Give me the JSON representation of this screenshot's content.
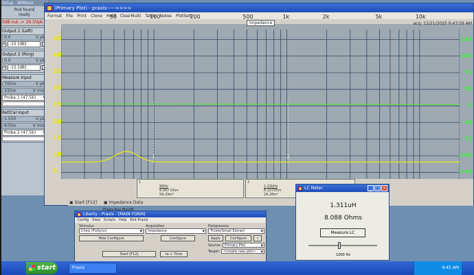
{
  "left_panel": {
    "tabs": [
      "Setup",
      "WiMove"
    ],
    "pod_found": "Pod found",
    "pod_ready": "ready",
    "warning": "0dB out -> 29.3Vpk",
    "output1": {
      "title": "Output 1 (Left)",
      "vpk_value": "0.0",
      "vpk_unit": "V pk",
      "db_value": "-15",
      "db_unit": "[dB]"
    },
    "output2": {
      "title": "Output 2 (Ring)",
      "vpk_value": "0.0",
      "vpk_unit": "V pk",
      "db_value": "-15",
      "db_unit": "[dB]"
    },
    "measure_input": {
      "title": "Measure Input",
      "vpk": "795m",
      "vpk_unit": "V pk",
      "vrms": "335m",
      "vrms_unit": "V rms",
      "probe": "Probe 1 (47.5k)"
    },
    "refcal_input": {
      "title": "Ref/Cal Input",
      "vpk": "1.550",
      "vpk_unit": "V pk",
      "vrms": "670m",
      "vrms_unit": "V rms",
      "probe": "Probe 2 (47.5k)"
    }
  },
  "plot_window": {
    "title": "(Primary Plot) - praxis----->>>>",
    "menu": [
      "Format",
      "File",
      "Print",
      "Clone",
      "Hold",
      "ClearMulti",
      "Table",
      "Notes",
      "PlotSets"
    ],
    "plot_label": "Impedance",
    "acq_stamp": "acq: 12/21/2025 9:43:59 AM",
    "x_ticks": [
      {
        "label": "50",
        "x": 50
      },
      {
        "label": "100",
        "x": 100
      },
      {
        "label": "200",
        "x": 200
      },
      {
        "label": "500",
        "x": 500
      },
      {
        "label": "1k",
        "x": 1000
      },
      {
        "label": "2k",
        "x": 2000
      },
      {
        "label": "5k",
        "x": 5000
      },
      {
        "label": "10k",
        "x": 10000
      }
    ],
    "y_left_ticks": [
      {
        "label": "45",
        "v": 45
      },
      {
        "label": "40",
        "v": 40
      },
      {
        "label": "35",
        "v": 35
      },
      {
        "label": "30",
        "v": 30
      },
      {
        "label": "25",
        "v": 25
      },
      {
        "label": "20",
        "v": 20
      },
      {
        "label": "15",
        "v": 15
      },
      {
        "label": "10",
        "v": 10
      },
      {
        "label": "5",
        "v": 5
      }
    ],
    "y_right_ticks": [
      {
        "label": "144",
        "v": 144
      },
      {
        "label": "108",
        "v": 108
      },
      {
        "label": "72",
        "v": 72
      },
      {
        "label": "36",
        "v": 36
      },
      {
        "label": "0",
        "v": 0
      },
      {
        "label": "-36",
        "v": -36
      },
      {
        "label": "-72",
        "v": -72
      },
      {
        "label": "-108",
        "v": -108
      },
      {
        "label": "-144",
        "v": -144
      }
    ],
    "cursor1": {
      "index": "1",
      "freq": "99Hz",
      "mag": "8.067 Ohm",
      "phase": "59.29m°"
    },
    "cursor2": {
      "index": "2",
      "freq": "1.02kHz",
      "mag": "8.1070hm",
      "phase": "29.28m°"
    },
    "status_start": "Start [F12]",
    "status_data": "Impedance Data",
    "colors": {
      "magnitude": "#e3e51a",
      "phase": "#52e035",
      "grid": "#2f4a63",
      "background": "#9ea9b2"
    }
  },
  "main_form": {
    "title": "Liberty - Praxis - [MAIN FORM]",
    "menu": [
      "Config",
      "View",
      "Scripts",
      "Help",
      "Exit Praxis"
    ],
    "stimulus_label": "Stimulus",
    "stimulus_value": "Chirp (FixSync)",
    "hide_configure": "Hide Configure",
    "acquisition_label": "Acquisition",
    "acquisition_value": "Impedance",
    "configure": "Configure",
    "postprocess_label": "Postprocess",
    "postprocess_value": "Thiele/Small Extract",
    "apply": "Apply",
    "configure2": "Configure",
    "start": "Start [F12]",
    "to_time": "to > Time",
    "source_label": "Source:",
    "source_value": "Primary Plot",
    "target_label": "Target:",
    "target_value": "<create new plot>",
    "behind_title": "Praxis-Aux MainW"
  },
  "lc_meter": {
    "title": "LC Meter",
    "inductance": "1.311uH",
    "resistance": "8.088 Ohms",
    "measure_button": "Measure LC",
    "freq_label": "1000 Hz",
    "freq_fraction": 0.45
  },
  "taskbar": {
    "start": "start",
    "item": "Praxis",
    "clock": "9:45 AM"
  }
}
